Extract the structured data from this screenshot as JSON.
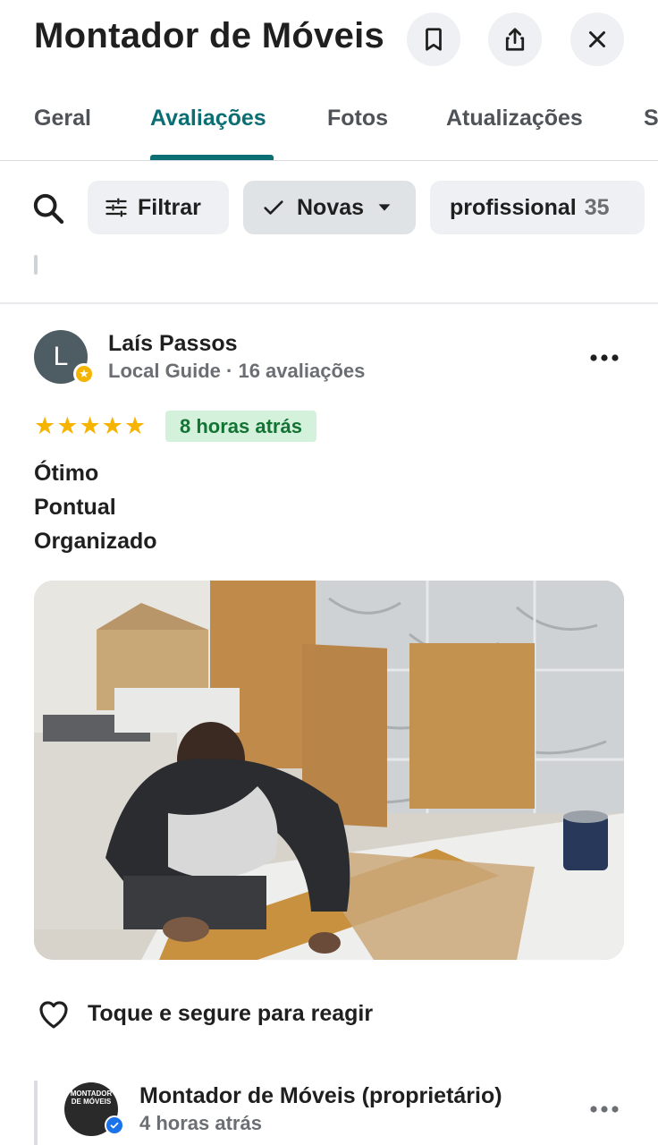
{
  "header": {
    "title": "Montador de Móveis",
    "bookmark_icon": "bookmark-icon",
    "share_icon": "share-icon",
    "close_icon": "close-icon"
  },
  "tabs": [
    {
      "label": "Geral",
      "active": false
    },
    {
      "label": "Avaliações",
      "active": true
    },
    {
      "label": "Fotos",
      "active": false
    },
    {
      "label": "Atualizações",
      "active": false
    },
    {
      "label": "S",
      "active": false
    }
  ],
  "filters": {
    "search_icon": "search-icon",
    "filter_label": "Filtrar",
    "sort_label": "Novas",
    "topic_label": "profissional",
    "topic_count": "35"
  },
  "review": {
    "avatar_initial": "L",
    "name": "Laís Passos",
    "meta": "Local Guide · 16 avaliações",
    "rating": 5,
    "time": "8 horas atrás",
    "lines": [
      "Ótimo",
      "Pontual",
      "Organizado"
    ],
    "react_label": "Toque e segure para reagir"
  },
  "owner_reply": {
    "name": "Montador de Móveis (proprietário)",
    "time": "4 horas atrás",
    "avatar_text": "MONTADOR DE MÓVEIS"
  },
  "colors": {
    "accent": "#0b6e73",
    "star": "#f6b400",
    "badge_bg": "#d4f1dc",
    "badge_text": "#137333"
  }
}
